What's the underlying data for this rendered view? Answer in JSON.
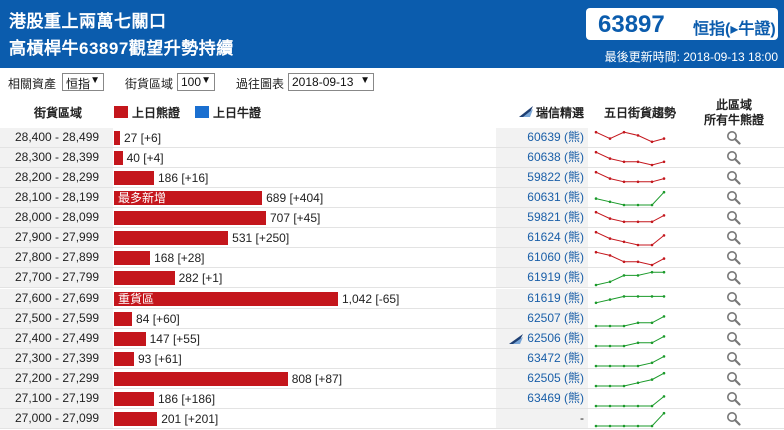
{
  "header": {
    "headline_line1": "港股重上兩萬七關口",
    "headline_line2": "高槓桿牛63897觀望升勢持續",
    "index_value": "63897",
    "index_label": "恒指(▸牛證)",
    "last_updated": "最後更新時間: 2018-09-13 18:00"
  },
  "filters": {
    "asset_label": "相關資產",
    "asset_value": "恒指",
    "zone_label": "街貨區域",
    "zone_value": "100",
    "past_label": "過往圖表",
    "past_value": "2018-09-13"
  },
  "table_header": {
    "range_col": "街貨區域",
    "bear_legend": "上日熊證",
    "bull_legend": "上日牛證",
    "strike_col": "瑞信精選",
    "trend_col": "五日街貨趨勢",
    "all_col_line1": "此區域",
    "all_col_line2": "所有牛熊證"
  },
  "colors": {
    "header_bg": "#0b5cad",
    "bear": "#c4161c",
    "bull": "#1a6fd0",
    "trend_down": "#c4161c",
    "trend_up": "#1a9a2a"
  },
  "rows": [
    {
      "range": "28,400 - 28,499",
      "value": 27,
      "bar_text": "27 [+6]",
      "tag": "",
      "strike": "60639 (熊)",
      "market_icon": false,
      "trend": "down",
      "spark": [
        5,
        3,
        5,
        4,
        2,
        3
      ]
    },
    {
      "range": "28,300 - 28,399",
      "value": 40,
      "bar_text": "40 [+4]",
      "tag": "",
      "strike": "60638 (熊)",
      "market_icon": false,
      "trend": "down",
      "spark": [
        5,
        3,
        2,
        2,
        1,
        2
      ]
    },
    {
      "range": "28,200 - 28,299",
      "value": 186,
      "bar_text": "186 [+16]",
      "tag": "",
      "strike": "59822 (熊)",
      "market_icon": false,
      "trend": "down",
      "spark": [
        5,
        3,
        2,
        2,
        2,
        3
      ]
    },
    {
      "range": "28,100 - 28,199",
      "value": 689,
      "bar_text": "689 [+404]",
      "tag": "最多新增",
      "strike": "60631 (熊)",
      "market_icon": false,
      "trend": "up",
      "spark": [
        3,
        2,
        1,
        1,
        1,
        5
      ]
    },
    {
      "range": "28,000 - 28,099",
      "value": 707,
      "bar_text": "707 [+45]",
      "tag": "",
      "strike": "59821 (熊)",
      "market_icon": false,
      "trend": "down",
      "spark": [
        5,
        3,
        2,
        2,
        2,
        4
      ]
    },
    {
      "range": "27,900 - 27,999",
      "value": 531,
      "bar_text": "531 [+250]",
      "tag": "",
      "strike": "61624 (熊)",
      "market_icon": false,
      "trend": "down",
      "spark": [
        5,
        3,
        2,
        1,
        1,
        4
      ]
    },
    {
      "range": "27,800 - 27,899",
      "value": 168,
      "bar_text": "168 [+28]",
      "tag": "",
      "strike": "61060 (熊)",
      "market_icon": false,
      "trend": "down",
      "spark": [
        5,
        4,
        2,
        2,
        1,
        3
      ]
    },
    {
      "range": "27,700 - 27,799",
      "value": 282,
      "bar_text": "282 [+1]",
      "tag": "",
      "strike": "61919 (熊)",
      "market_icon": false,
      "trend": "up",
      "spark": [
        1,
        2,
        4,
        4,
        5,
        5
      ]
    },
    {
      "range": "27,600 - 27,699",
      "value": 1042,
      "bar_text": "1,042 [-65]",
      "tag": "重貨區",
      "strike": "61619 (熊)",
      "market_icon": false,
      "trend": "up",
      "spark": [
        2,
        3,
        4,
        4,
        4,
        4
      ]
    },
    {
      "range": "27,500 - 27,599",
      "value": 84,
      "bar_text": "84 [+60]",
      "tag": "",
      "strike": "62507 (熊)",
      "market_icon": false,
      "trend": "up",
      "spark": [
        1,
        1,
        1,
        2,
        2,
        4
      ]
    },
    {
      "range": "27,400 - 27,499",
      "value": 147,
      "bar_text": "147 [+55]",
      "tag": "",
      "strike": "62506 (熊)",
      "market_icon": true,
      "trend": "up",
      "spark": [
        1,
        1,
        1,
        2,
        2,
        4
      ]
    },
    {
      "range": "27,300 - 27,399",
      "value": 93,
      "bar_text": "93 [+61]",
      "tag": "",
      "strike": "63472 (熊)",
      "market_icon": false,
      "trend": "up",
      "spark": [
        1,
        1,
        1,
        1,
        2,
        4
      ]
    },
    {
      "range": "27,200 - 27,299",
      "value": 808,
      "bar_text": "808 [+87]",
      "tag": "",
      "strike": "62505 (熊)",
      "market_icon": false,
      "trend": "up",
      "spark": [
        1,
        1,
        1,
        2,
        3,
        5
      ]
    },
    {
      "range": "27,100 - 27,199",
      "value": 186,
      "bar_text": "186 [+186]",
      "tag": "",
      "strike": "63469 (熊)",
      "market_icon": false,
      "trend": "up",
      "spark": [
        1,
        1,
        1,
        1,
        1,
        4
      ]
    },
    {
      "range": "27,000 - 27,099",
      "value": 201,
      "bar_text": "201 [+201]",
      "tag": "",
      "strike": "-",
      "market_icon": false,
      "trend": "up",
      "spark": [
        1,
        1,
        1,
        1,
        1,
        5
      ]
    }
  ]
}
